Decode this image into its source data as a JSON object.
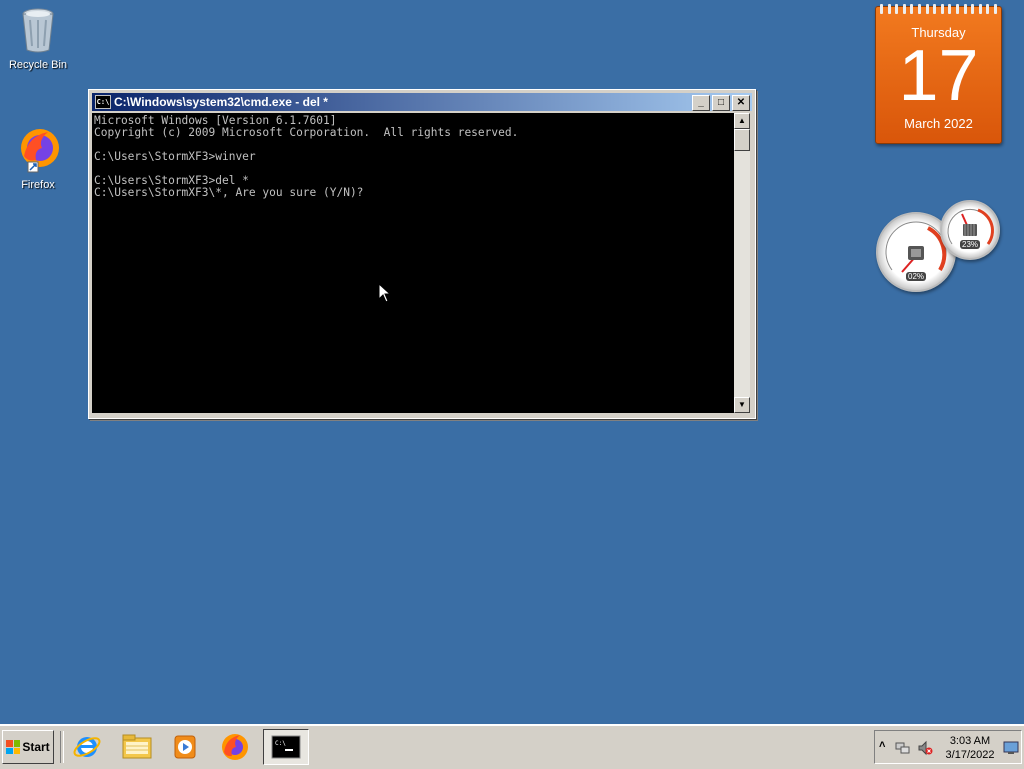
{
  "desktop": {
    "icons": [
      {
        "label": "Recycle Bin",
        "icon": "recycle-bin-icon"
      },
      {
        "label": "Firefox",
        "icon": "firefox-icon"
      }
    ],
    "background_color": "#3a6ea5"
  },
  "calendar_gadget": {
    "day_name": "Thursday",
    "day_number": "17",
    "month_year": "March 2022",
    "color": "#e8681a"
  },
  "meter_gadget": {
    "cpu_percent": "02%",
    "memory_percent": "23%"
  },
  "cmd_window": {
    "title": "C:\\Windows\\system32\\cmd.exe - del *",
    "icon_text": "C:\\",
    "buttons": {
      "minimize": "_",
      "maximize": "□",
      "close": "✕"
    },
    "lines": [
      "Microsoft Windows [Version 6.1.7601]",
      "Copyright (c) 2009 Microsoft Corporation.  All rights reserved.",
      "",
      "C:\\Users\\StormXF3>winver",
      "",
      "C:\\Users\\StormXF3>del *",
      "C:\\Users\\StormXF3\\*, Are you sure (Y/N)?"
    ]
  },
  "taskbar": {
    "start_label": "Start",
    "pinned": [
      {
        "name": "internet-explorer-icon"
      },
      {
        "name": "windows-explorer-icon"
      },
      {
        "name": "media-player-icon"
      },
      {
        "name": "firefox-icon"
      },
      {
        "name": "cmd-icon",
        "active": true
      }
    ],
    "tray": {
      "time": "3:03 AM",
      "date": "3/17/2022",
      "show_hidden": "˄"
    }
  }
}
